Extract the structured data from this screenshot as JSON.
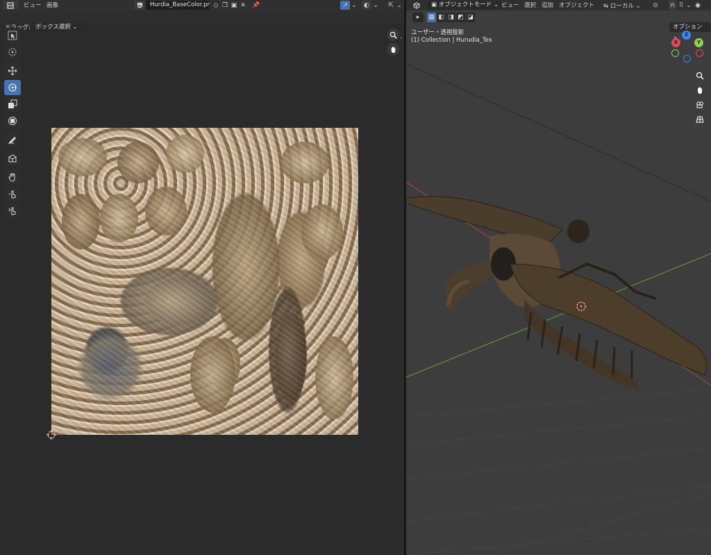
{
  "image_editor": {
    "menu": {
      "view": "ビュー",
      "image": "画像"
    },
    "image_name": "Hurdia_BaseColor.png",
    "drag_label": "ドラッグ:",
    "drag_mode": "ボックス選択",
    "tools": [
      {
        "name": "select-box-tool",
        "active": false
      },
      {
        "name": "cursor-tool",
        "active": false
      },
      {
        "name": "move-tool",
        "active": false
      },
      {
        "name": "rotate-tool",
        "active": true
      },
      {
        "name": "scale-tool",
        "active": false
      },
      {
        "name": "transform-tool",
        "active": false
      },
      {
        "name": "annotate-tool",
        "active": false
      },
      {
        "name": "rip-region-tool",
        "active": false
      },
      {
        "name": "grab-tool",
        "active": false
      },
      {
        "name": "relax-tool",
        "active": false
      },
      {
        "name": "pinch-tool",
        "active": false
      }
    ]
  },
  "viewport": {
    "mode": "オブジェクトモード",
    "menu": {
      "view": "ビュー",
      "select": "選択",
      "add": "追加",
      "object": "オブジェクト"
    },
    "orientation": "ローカル",
    "options": "オプション",
    "projection": "ユーザー・透視投影",
    "collection": "(1) Collection | Hurudia_Tex",
    "gizmo": {
      "x": "X",
      "y": "Y",
      "z": "Z"
    }
  },
  "colors": {
    "accent": "#4772b3",
    "axis_x": "#e34b5c",
    "axis_y": "#8fd14f",
    "axis_z": "#3f87e6"
  }
}
